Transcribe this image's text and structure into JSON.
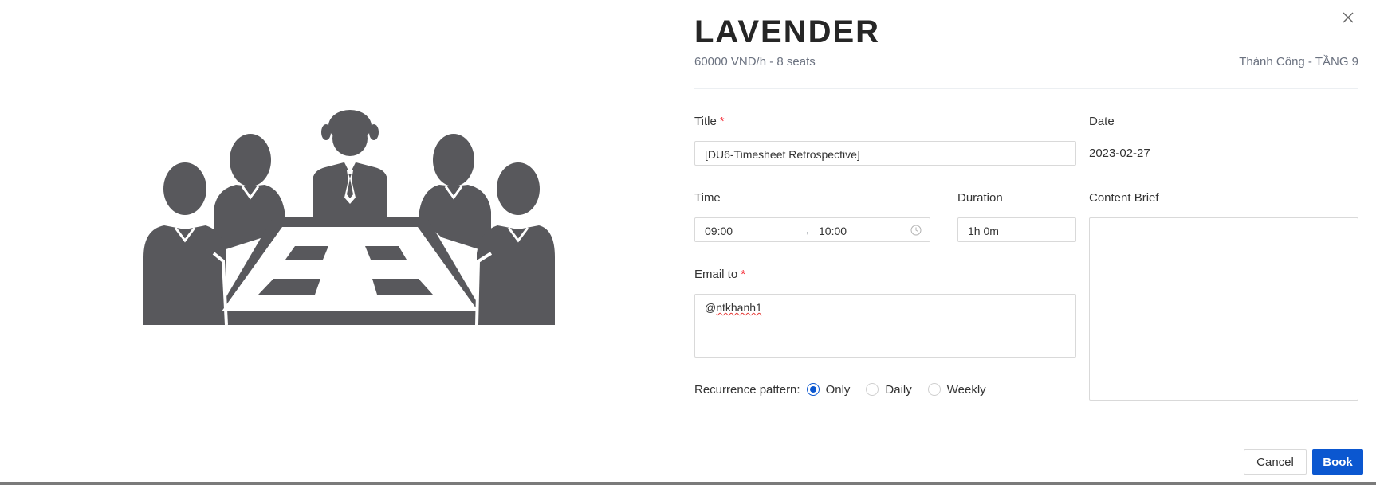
{
  "room": {
    "name": "LAVENDER",
    "subtitle": "60000 VND/h - 8 seats",
    "location": "Thành Công - TẦNG 9"
  },
  "form": {
    "title_label": "Title",
    "title_value": "[DU6-Timesheet Retrospective]",
    "date_label": "Date",
    "date_value": "2023-02-27",
    "time_label": "Time",
    "time_start": "09:00",
    "time_end": "10:00",
    "duration_label": "Duration",
    "duration_value": "1h 0m",
    "content_label": "Content Brief",
    "content_value": "",
    "email_label": "Email to",
    "email_prefix": "@",
    "email_value": "ntkhanh1",
    "recurrence_label": "Recurrence pattern:",
    "recurrence_options": [
      "Only",
      "Daily",
      "Weekly"
    ],
    "recurrence_selected": "Only",
    "required_mark": "*",
    "arrow": "→"
  },
  "buttons": {
    "cancel": "Cancel",
    "book": "Book"
  },
  "icons": {
    "close": "close-icon",
    "clock": "clock-icon",
    "meeting": "meeting-illustration"
  },
  "colors": {
    "primary": "#0b57d0",
    "required": "#f5222d",
    "illustration": "#58585c"
  }
}
